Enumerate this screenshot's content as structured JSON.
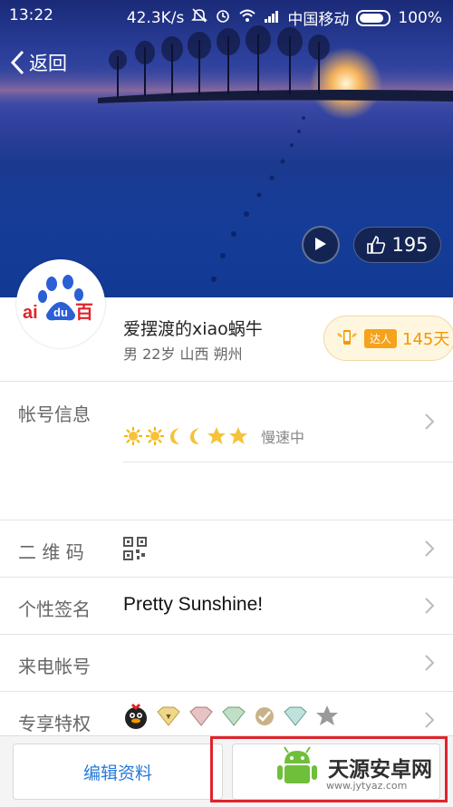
{
  "status_bar": {
    "time": "13:22",
    "speed": "42.3K/s",
    "carrier": "中国移动",
    "battery": "100%"
  },
  "nav": {
    "back_label": "返回"
  },
  "hero": {
    "like_count": "195"
  },
  "profile": {
    "avatar_logo": "ai du 百",
    "username": "爱摆渡的xiao蜗牛",
    "meta": "男 22岁 山西 朔州",
    "expert_tag": "达人",
    "expert_days": "145天"
  },
  "rows": {
    "account": {
      "label": "帐号信息",
      "level_icons": [
        "sun-icon",
        "sun-icon",
        "moon-icon",
        "moon-icon",
        "star-icon",
        "star-icon"
      ],
      "level_status": "慢速中"
    },
    "qrcode": {
      "label": "二 维 码"
    },
    "signature": {
      "label": "个性签名",
      "value": "Pretty Sunshine!"
    },
    "caller": {
      "label": "来电帐号"
    },
    "privilege": {
      "label": "专享特权"
    }
  },
  "bottom": {
    "edit_label": "编辑资料",
    "chat_label": ""
  },
  "watermark": {
    "text": "天源安卓网",
    "url": "www.jytyaz.com"
  },
  "colors": {
    "accent_blue": "#2a7ad6",
    "expert_orange": "#f39800",
    "highlight_red": "#e0242c"
  }
}
